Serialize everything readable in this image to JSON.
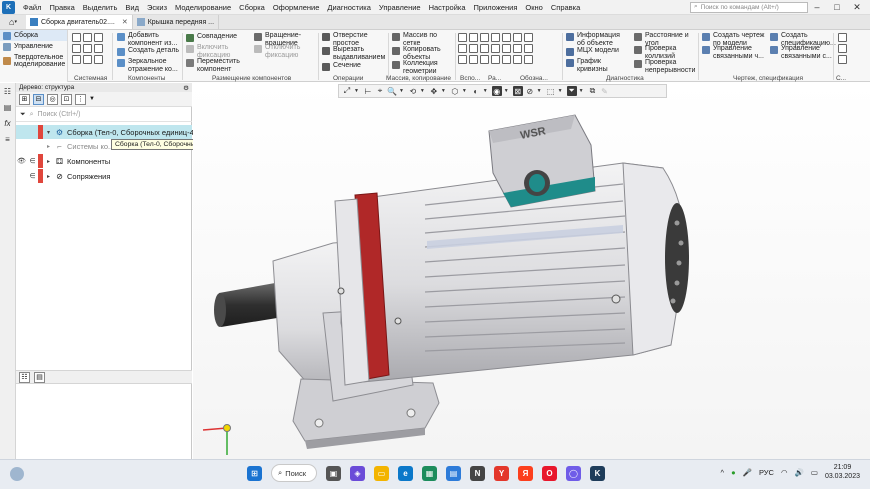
{
  "menubar": {
    "logo": "K",
    "items": [
      "Файл",
      "Правка",
      "Выделить",
      "Вид",
      "Эскиз",
      "Моделирование",
      "Сборка",
      "Оформление",
      "Диагностика",
      "Управление",
      "Настройка",
      "Приложения",
      "Окно",
      "Справка"
    ],
    "command_search_placeholder": "Поиск по командам (Alt+/)"
  },
  "tabs": [
    {
      "label": "Сборка двигатель02....",
      "active": true
    },
    {
      "label": "Крышка передняя ...",
      "active": false
    }
  ],
  "ribbon_left": {
    "items": [
      "Сборка",
      "Управление",
      "Твердотельное моделирование"
    ]
  },
  "ribbon": {
    "sections": {
      "system": "Системная",
      "components": "Компоненты",
      "placement": "Размещение компонентов",
      "operations": "Операции",
      "array": "Массив, копирование",
      "aux": "Вспо...",
      "dims": "Ра...",
      "desig": "Обозна...",
      "diagnostics": "Диагностика",
      "drawing": "Чертеж, спецификация",
      "s": "С..."
    },
    "buttons": {
      "add_component": "Добавить компонент из...",
      "create_part": "Создать деталь",
      "mirror_component": "Зеркальное отражение ко...",
      "coincidence": "Совпадение",
      "enable_fixation": "Включить фиксацию",
      "move_component": "Переместить компонент",
      "rotation_rotation": "Вращение-вращение",
      "disable_fixation": "Отключить фиксацию",
      "hole_simple": "Отверстие простое",
      "cut_extrude": "Вырезать выдавливанием",
      "section": "Сечение",
      "array_grid": "Массив по сетке",
      "copy_objects": "Копировать объекты",
      "geometry_collection": "Коллекция геометрии",
      "object_info": "Информация об объекте",
      "mcs_model": "МЦХ модели",
      "curvature_graph": "График кривизны",
      "distance_angle": "Расстояние и угол",
      "check_collisions": "Проверка коллизий",
      "check_continuity": "Проверка непрерывности",
      "create_drawing": "Создать чертеж по модели",
      "manage_linked": "Управление связанными ч...",
      "create_spec": "Создать спецификацию...",
      "manage_linked_spec": "Управление связанными с..."
    }
  },
  "tree": {
    "header": "Дерево: структура",
    "search_placeholder": "Поиск (Ctrl+/)",
    "rows": [
      {
        "label": "(Тел-0, Сборочных единиц-4...",
        "prefix": "Сборка",
        "selected": true
      },
      {
        "label": "Системы ко..."
      },
      {
        "label": "Компоненты"
      },
      {
        "label": "Сопряжения"
      }
    ],
    "tooltip": "Сборка (Тел-0, Сборочных единиц-4, Деталей-29)"
  },
  "model": {
    "nameplate": "WSR",
    "colors": {
      "body": "#e4e4e6",
      "body_shadow": "#b9b9bd",
      "accent_ring": "#b02828",
      "terminal_box_teal": "#1f8c8a",
      "shaft": "#3c3c3c"
    }
  },
  "taskbar": {
    "search_label": "Поиск",
    "language": "РУС",
    "time": "21:09",
    "date": "03.03.2023"
  }
}
